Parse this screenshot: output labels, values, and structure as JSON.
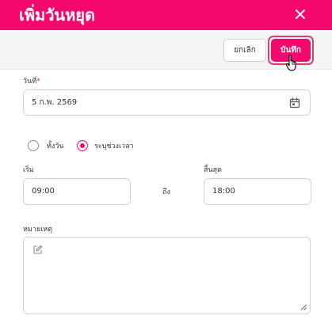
{
  "dialog": {
    "title": "เพิ่มวันหยุด",
    "close_icon": "close-icon"
  },
  "toolbar": {
    "cancel_label": "ยกเลิก",
    "save_label": "บันทึก"
  },
  "form": {
    "date": {
      "label": "วันที่",
      "required_mark": "*",
      "value": "5 ก.พ. 2569",
      "icon": "calendar-icon"
    },
    "period": {
      "options": [
        {
          "label": "ทั้งวัน",
          "selected": false
        },
        {
          "label": "ระบุช่วงเวลา",
          "selected": true
        }
      ]
    },
    "start": {
      "label": "เริ่ม",
      "value": "09:00"
    },
    "separator": "ถึง",
    "end": {
      "label": "สิ้นสุด",
      "value": "18:00"
    },
    "note": {
      "label": "หมายเหตุ",
      "value": "",
      "icon": "edit-icon"
    }
  },
  "colors": {
    "accent": "#f5086e",
    "focus_ring": "#d8425f",
    "toolbar_bg": "#f4f5f7",
    "border": "#cfd3d8"
  }
}
